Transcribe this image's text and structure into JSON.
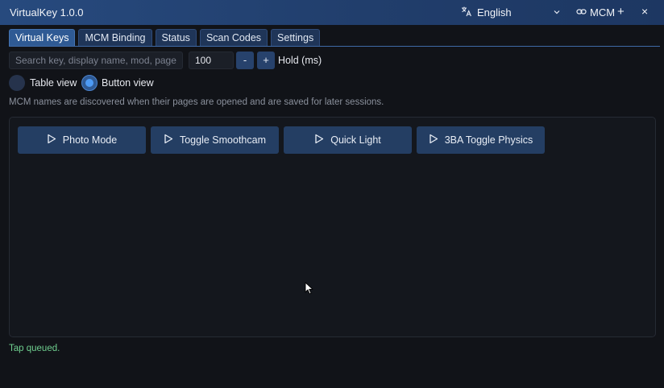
{
  "app": {
    "title": "VirtualKey 1.0.0"
  },
  "titlebar": {
    "language_icon": "translate-icon",
    "language": "English",
    "language_chevron_icon": "chevron-down-icon",
    "link_icon": "link-icon",
    "mcm_label": "MCM",
    "add_label": "+",
    "close_label": "×"
  },
  "tabs": [
    {
      "label": "Virtual Keys",
      "active": true
    },
    {
      "label": "MCM Binding",
      "active": false
    },
    {
      "label": "Status",
      "active": false
    },
    {
      "label": "Scan Codes",
      "active": false
    },
    {
      "label": "Settings",
      "active": false
    }
  ],
  "toolbar": {
    "search_placeholder": "Search key, display name, mod, page, or MCM name",
    "hold_value": "100",
    "minus_label": "-",
    "plus_label": "+",
    "hold_label": "Hold (ms)"
  },
  "views": {
    "table_label": "Table view",
    "button_label": "Button view",
    "selected": "Button view"
  },
  "hint": "MCM names are discovered when their pages are opened and are saved for later sessions.",
  "buttons": [
    {
      "label": "Photo Mode",
      "icon": "play-icon"
    },
    {
      "label": "Toggle Smoothcam",
      "icon": "play-icon"
    },
    {
      "label": "Quick Light",
      "icon": "play-icon"
    },
    {
      "label": "3BA Toggle Physics",
      "icon": "play-icon"
    }
  ],
  "status": "Tap queued.",
  "colors": {
    "titlebar": "#274a7e",
    "accent": "#4d9bf5",
    "status_ok": "#6fcf8f"
  }
}
